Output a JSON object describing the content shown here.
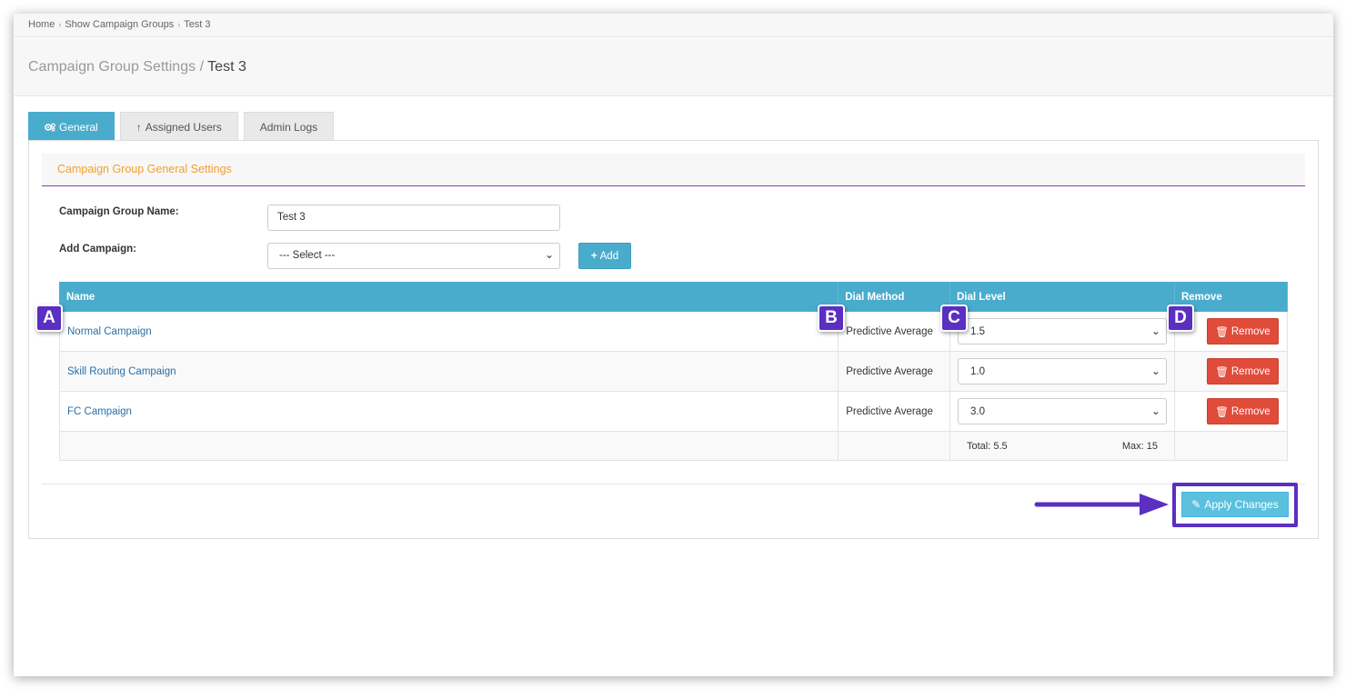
{
  "breadcrumb": [
    "Home",
    "Show Campaign Groups",
    "Test 3"
  ],
  "header": {
    "section": "Campaign Group Settings",
    "separator": "/",
    "current": "Test 3"
  },
  "tabs": [
    {
      "label": "General",
      "icon": "gears-icon",
      "active": true
    },
    {
      "label": "Assigned Users",
      "icon": "up-arrow-icon",
      "active": false
    },
    {
      "label": "Admin Logs",
      "icon": "",
      "active": false
    }
  ],
  "section_title": "Campaign Group General Settings",
  "form": {
    "name_label": "Campaign Group Name:",
    "name_value": "Test 3",
    "add_label": "Add Campaign:",
    "add_select_value": "--- Select ---",
    "add_button": "Add"
  },
  "table": {
    "headers": [
      "Name",
      "Dial Method",
      "Dial Level",
      "Remove"
    ],
    "rows": [
      {
        "name": "Normal Campaign",
        "dial_method": "Predictive Average",
        "dial_level": "1.5",
        "remove": "Remove"
      },
      {
        "name": "Skill Routing Campaign",
        "dial_method": "Predictive Average",
        "dial_level": "1.0",
        "remove": "Remove"
      },
      {
        "name": "FC Campaign",
        "dial_method": "Predictive Average",
        "dial_level": "3.0",
        "remove": "Remove"
      }
    ],
    "total": "Total: 5.5",
    "max": "Max: 15"
  },
  "apply_button": "Apply Changes",
  "markers": [
    "A",
    "B",
    "C",
    "D"
  ],
  "colors": {
    "accent": "#4aaccd",
    "danger": "#e04b3a",
    "annotation": "#5a2fc2",
    "section_title": "#f0a030"
  }
}
